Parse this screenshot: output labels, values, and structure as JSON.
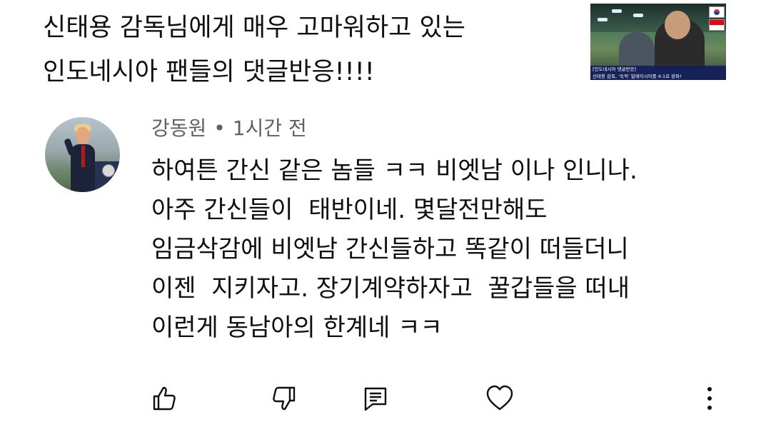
{
  "video": {
    "title_lines": [
      "신태용 감독님에게 매우 고마워하고 있는",
      "인도네시아 팬들의 댓글반응!!!!"
    ],
    "thumbnail": {
      "caption_line1": "[인도네시아 댓글반응]",
      "caption_line2": "신태용 감독, '숙적' 말레이시아를 4:1로 완파!"
    }
  },
  "comment": {
    "author": "강동원",
    "separator": "•",
    "time": "1시간 전",
    "lines": [
      "하여튼 간신 같은 놈들 ㅋㅋ 비엣남 이나 인니나.",
      "아주 간신들이  태반이네. 몇달전만해도",
      "임금삭감에 비엣남 간신들하고 똑같이 떠들더니",
      "이젠  지키자고. 장기계약하자고  꿀갑들을 떠내",
      "이런게 동남아의 한계네 ㅋㅋ"
    ]
  },
  "actions": {
    "icons": [
      "thumbs-up-icon",
      "thumbs-down-icon",
      "reply-icon",
      "heart-icon",
      "more-vert-icon"
    ]
  },
  "colors": {
    "text_primary": "#0f0f0f",
    "text_secondary": "#606060",
    "background": "#ffffff"
  }
}
